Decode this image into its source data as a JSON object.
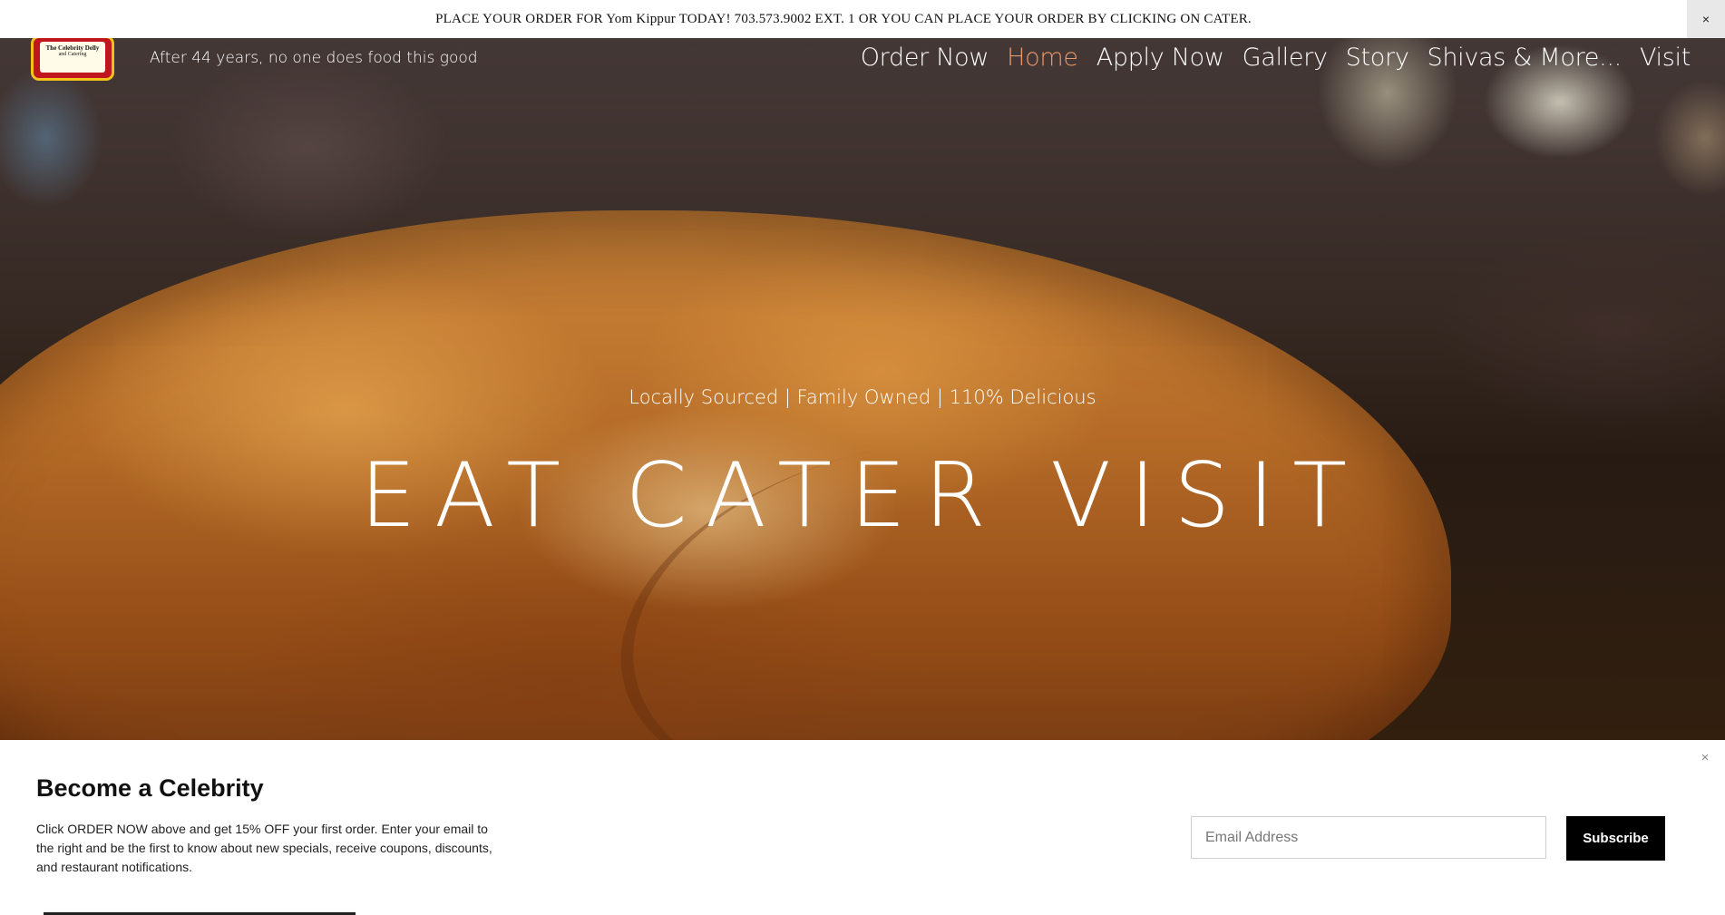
{
  "announcement": {
    "text": "PLACE YOUR ORDER FOR Yom Kippur TODAY! 703.573.9002 EXT. 1 OR YOU CAN PLACE YOUR ORDER BY CLICKING ON CATER.",
    "close_label": "×"
  },
  "header": {
    "logo": {
      "line1": "The Celebrity Delly",
      "line2": "and Catering"
    },
    "tagline": "After 44 years, no one does food this good",
    "nav": [
      {
        "label": "Order Now"
      },
      {
        "label": "Home"
      },
      {
        "label": "Apply Now"
      },
      {
        "label": "Gallery"
      },
      {
        "label": "Story"
      },
      {
        "label": "Shivas & More..."
      },
      {
        "label": "Visit"
      }
    ],
    "active_nav": "Home",
    "active_color": "#e9976a"
  },
  "hero": {
    "subtitle": "Locally Sourced | Family Owned | 110% Delicious",
    "title": "EAT  CATER  VISIT"
  },
  "newsletter": {
    "title": "Become a Celebrity",
    "body": "Click ORDER NOW above and get 15% OFF your first order. Enter your email to the right and be the first to know about new specials, receive coupons, discounts, and restaurant notifications.",
    "email_placeholder": "Email Address",
    "subscribe_label": "Subscribe",
    "close_label": "×"
  }
}
